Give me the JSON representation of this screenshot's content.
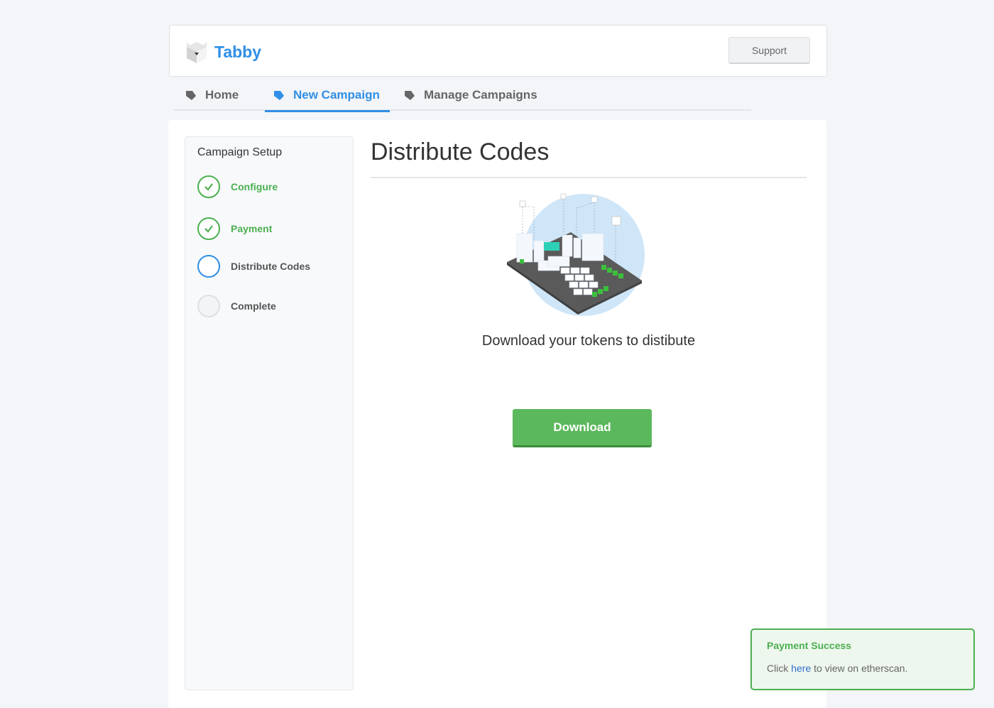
{
  "header": {
    "brand": "Tabby",
    "support_label": "Support"
  },
  "nav": {
    "tabs": [
      {
        "label": "Home",
        "icon": "arrow-tag-icon"
      },
      {
        "label": "New Campaign",
        "icon": "arrow-tag-icon",
        "active": true
      },
      {
        "label": "Manage Campaigns",
        "icon": "arrow-tag-icon"
      }
    ]
  },
  "sidebar": {
    "title": "Campaign Setup",
    "steps": [
      {
        "label": "Configure",
        "status": "done"
      },
      {
        "label": "Payment",
        "status": "done"
      },
      {
        "label": "Distribute Codes",
        "status": "current"
      },
      {
        "label": "Complete",
        "status": "pending"
      }
    ]
  },
  "main": {
    "title": "Distribute Codes",
    "subtitle": "Download your tokens to distibute",
    "download_label": "Download"
  },
  "toast": {
    "title": "Payment Success",
    "body_prefix": "Click ",
    "link": "here",
    "body_suffix": " to view on etherscan."
  },
  "colors": {
    "accent": "#2f8fe6",
    "success": "#4caf50",
    "button_green": "#5cb85c"
  }
}
